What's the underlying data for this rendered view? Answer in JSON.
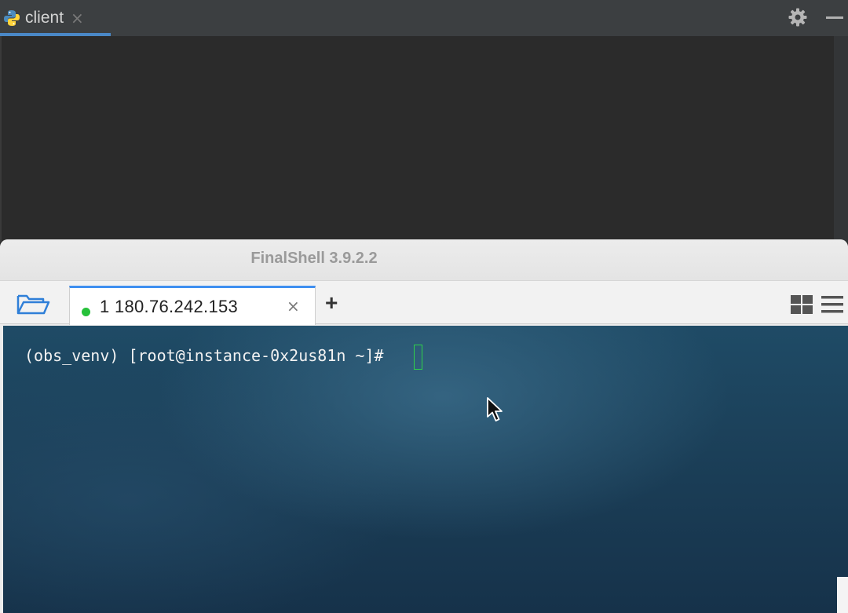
{
  "ide": {
    "tab_label": "client",
    "tab_close": "×",
    "icons": {
      "file": "python-file-icon",
      "settings": "gear-icon",
      "minimize": "minimize-icon"
    }
  },
  "finalshell": {
    "window_title": "FinalShell 3.9.2.2",
    "tabs": [
      {
        "label": "1 180.76.242.153",
        "status": "connected",
        "status_color": "#26c13a",
        "close": "×"
      }
    ],
    "add_tab": "+",
    "icons": {
      "folder": "folder-open-icon",
      "layout": "grid-layout-icon",
      "menu": "hamburger-menu-icon"
    },
    "accent_color": "#3f8ff0"
  },
  "terminal": {
    "prompt": "(obs_venv) [root@instance-0x2us81n ~]# ",
    "cursor_color": "#2fd14a"
  }
}
